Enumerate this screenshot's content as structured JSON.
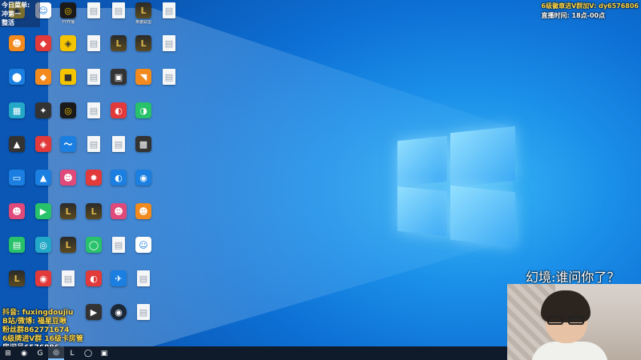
{
  "overlays": {
    "top_left_lines": [
      "今日菜单:",
      "冲第一",
      "整活"
    ],
    "top_right_lines": [
      "6级徽章进V群加V: dy6576806",
      "直播时间: 18点-00点"
    ],
    "bottom_left_lines": [
      "抖音: fuxingdoujiu",
      "B站/微博: 福星豆啾",
      "粉丝群862771674",
      "6级牌进V群 16级卡房管",
      "房间号6576886"
    ],
    "danmu": "幻境:谁问你了？"
  },
  "desktop_icons": [
    {
      "label": "",
      "glyph": "yellow",
      "symbol": "◉"
    },
    {
      "label": "",
      "glyph": "white",
      "symbol": "☺"
    },
    {
      "label": "YY开播",
      "glyph": "ring",
      "symbol": "◎"
    },
    {
      "label": "",
      "glyph": "doc",
      "symbol": "▤"
    },
    {
      "label": "",
      "glyph": "doc",
      "symbol": "▤"
    },
    {
      "label": "英雄联盟",
      "glyph": "lol",
      "symbol": "L"
    },
    {
      "label": "",
      "glyph": "doc",
      "symbol": "▤"
    },
    {
      "label": "",
      "glyph": "orange",
      "symbol": "☻"
    },
    {
      "label": "",
      "glyph": "red",
      "symbol": "◆"
    },
    {
      "label": "",
      "glyph": "yellow",
      "symbol": "◈"
    },
    {
      "label": "",
      "glyph": "doc",
      "symbol": "▤"
    },
    {
      "label": "",
      "glyph": "lol",
      "symbol": "L"
    },
    {
      "label": "",
      "glyph": "lol",
      "symbol": "L"
    },
    {
      "label": "",
      "glyph": "doc",
      "symbol": "▤"
    },
    {
      "label": "",
      "glyph": "blue",
      "symbol": "⬤"
    },
    {
      "label": "",
      "glyph": "orange",
      "symbol": "◆"
    },
    {
      "label": "",
      "glyph": "yellow",
      "symbol": "■"
    },
    {
      "label": "",
      "glyph": "doc",
      "symbol": "▤"
    },
    {
      "label": "",
      "glyph": "dark",
      "symbol": "▣"
    },
    {
      "label": "",
      "glyph": "orange",
      "symbol": "◥"
    },
    {
      "label": "",
      "glyph": "doc",
      "symbol": "▤"
    },
    {
      "label": "",
      "glyph": "teal",
      "symbol": "▦"
    },
    {
      "label": "",
      "glyph": "dark",
      "symbol": "✦"
    },
    {
      "label": "",
      "glyph": "ring",
      "symbol": "◎"
    },
    {
      "label": "",
      "glyph": "doc",
      "symbol": "▤"
    },
    {
      "label": "",
      "glyph": "red",
      "symbol": "◐"
    },
    {
      "label": "",
      "glyph": "green",
      "symbol": "◑"
    },
    {
      "label": "",
      "glyph": "dark",
      "symbol": "▲"
    },
    {
      "label": "",
      "glyph": "red",
      "symbol": "◈"
    },
    {
      "label": "",
      "glyph": "blue",
      "symbol": "〜"
    },
    {
      "label": "",
      "glyph": "doc",
      "symbol": "▤"
    },
    {
      "label": "",
      "glyph": "doc",
      "symbol": "▤"
    },
    {
      "label": "",
      "glyph": "dark",
      "symbol": "▩"
    },
    {
      "label": "",
      "glyph": "blue",
      "symbol": "▭"
    },
    {
      "label": "",
      "glyph": "blue",
      "symbol": "▲"
    },
    {
      "label": "",
      "glyph": "pink",
      "symbol": "☻"
    },
    {
      "label": "",
      "glyph": "red",
      "symbol": "✹"
    },
    {
      "label": "",
      "glyph": "blue",
      "symbol": "◐"
    },
    {
      "label": "",
      "glyph": "blue",
      "symbol": "◉"
    },
    {
      "label": "",
      "glyph": "pink",
      "symbol": "☻"
    },
    {
      "label": "",
      "glyph": "green",
      "symbol": "▶"
    },
    {
      "label": "",
      "glyph": "lol",
      "symbol": "L"
    },
    {
      "label": "",
      "glyph": "lol",
      "symbol": "L"
    },
    {
      "label": "",
      "glyph": "pink",
      "symbol": "☻"
    },
    {
      "label": "",
      "glyph": "orange",
      "symbol": "☻"
    },
    {
      "label": "",
      "glyph": "green",
      "symbol": "▤"
    },
    {
      "label": "",
      "glyph": "teal",
      "symbol": "◎"
    },
    {
      "label": "",
      "glyph": "lol",
      "symbol": "L"
    },
    {
      "label": "",
      "glyph": "green",
      "symbol": "◯"
    },
    {
      "label": "",
      "glyph": "doc",
      "symbol": "▤"
    },
    {
      "label": "",
      "glyph": "white",
      "symbol": "☺"
    },
    {
      "label": "",
      "glyph": "lol",
      "symbol": "L"
    },
    {
      "label": "",
      "glyph": "red",
      "symbol": "◉"
    },
    {
      "label": "",
      "glyph": "doc",
      "symbol": "▤"
    },
    {
      "label": "",
      "glyph": "red",
      "symbol": "◐"
    },
    {
      "label": "",
      "glyph": "blue",
      "symbol": "✈"
    },
    {
      "label": "",
      "glyph": "doc",
      "symbol": "▤"
    },
    {
      "label": "",
      "glyph": "dark",
      "symbol": "▶"
    },
    {
      "label": "",
      "glyph": "steam",
      "symbol": "◉"
    },
    {
      "label": "",
      "glyph": "doc",
      "symbol": "▤"
    }
  ],
  "taskbar": [
    {
      "name": "start-button",
      "symbol": "⊞",
      "active": false
    },
    {
      "name": "taskbar-app-chrome",
      "symbol": "◉",
      "active": false
    },
    {
      "name": "taskbar-app-g",
      "symbol": "G",
      "active": false
    },
    {
      "name": "taskbar-app-obs",
      "symbol": "◎",
      "active": true
    },
    {
      "name": "taskbar-app-lol",
      "symbol": "L",
      "active": false
    },
    {
      "name": "taskbar-app-ring",
      "symbol": "◯",
      "active": false
    },
    {
      "name": "taskbar-app-orange",
      "symbol": "▣",
      "active": false
    }
  ]
}
